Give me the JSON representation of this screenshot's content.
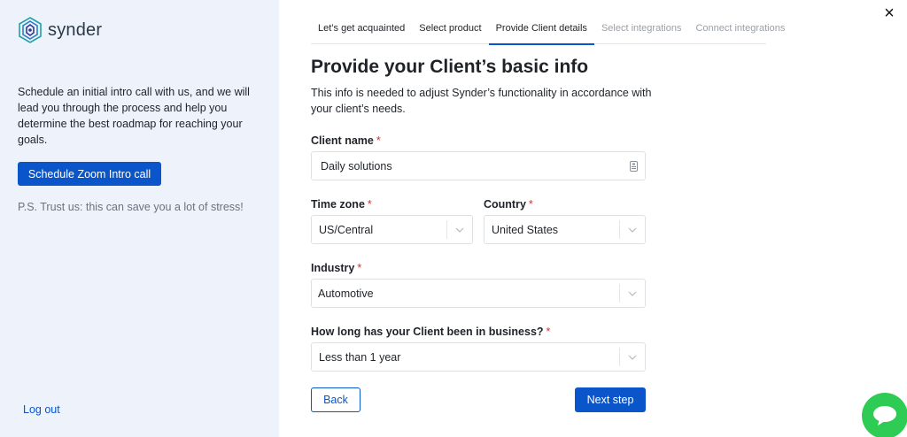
{
  "brand": {
    "name": "synder"
  },
  "sidebar": {
    "intro_text": "Schedule an initial intro call with us, and we will lead you through the process and help you determine the best roadmap for reaching your goals.",
    "zoom_button": "Schedule Zoom Intro call",
    "ps_text": "P.S. Trust us: this can save you a lot of stress!",
    "logout": "Log out"
  },
  "close_label": "×",
  "tabs": [
    {
      "label": "Let’s get acquainted",
      "state": "done"
    },
    {
      "label": "Select product",
      "state": "done"
    },
    {
      "label": "Provide Client details",
      "state": "active"
    },
    {
      "label": "Select integrations",
      "state": "disabled"
    },
    {
      "label": "Connect integrations",
      "state": "disabled"
    }
  ],
  "form": {
    "title": "Provide your Client’s basic info",
    "subtitle": "This info is needed to adjust Synder’s functionality in accordance with your client’s needs.",
    "required_mark": "*",
    "client_name": {
      "label": "Client name",
      "value": "Daily solutions"
    },
    "time_zone": {
      "label": "Time zone",
      "value": "US/Central"
    },
    "country": {
      "label": "Country",
      "value": "United States"
    },
    "industry": {
      "label": "Industry",
      "value": "Automotive"
    },
    "business_age": {
      "label": "How long has your Client been in business?",
      "value": "Less than 1 year"
    },
    "back": "Back",
    "next": "Next step"
  },
  "colors": {
    "accent": "#0a55c9",
    "sidebar_bg": "#eef2fa",
    "required": "#d93025",
    "chat": "#2ecc54"
  },
  "icons": {
    "logo": "synder-hexagon-logo",
    "close": "close-icon",
    "chevron": "chevron-down-icon",
    "input_action": "contact-card-icon",
    "chat": "chat-bubble-icon"
  }
}
